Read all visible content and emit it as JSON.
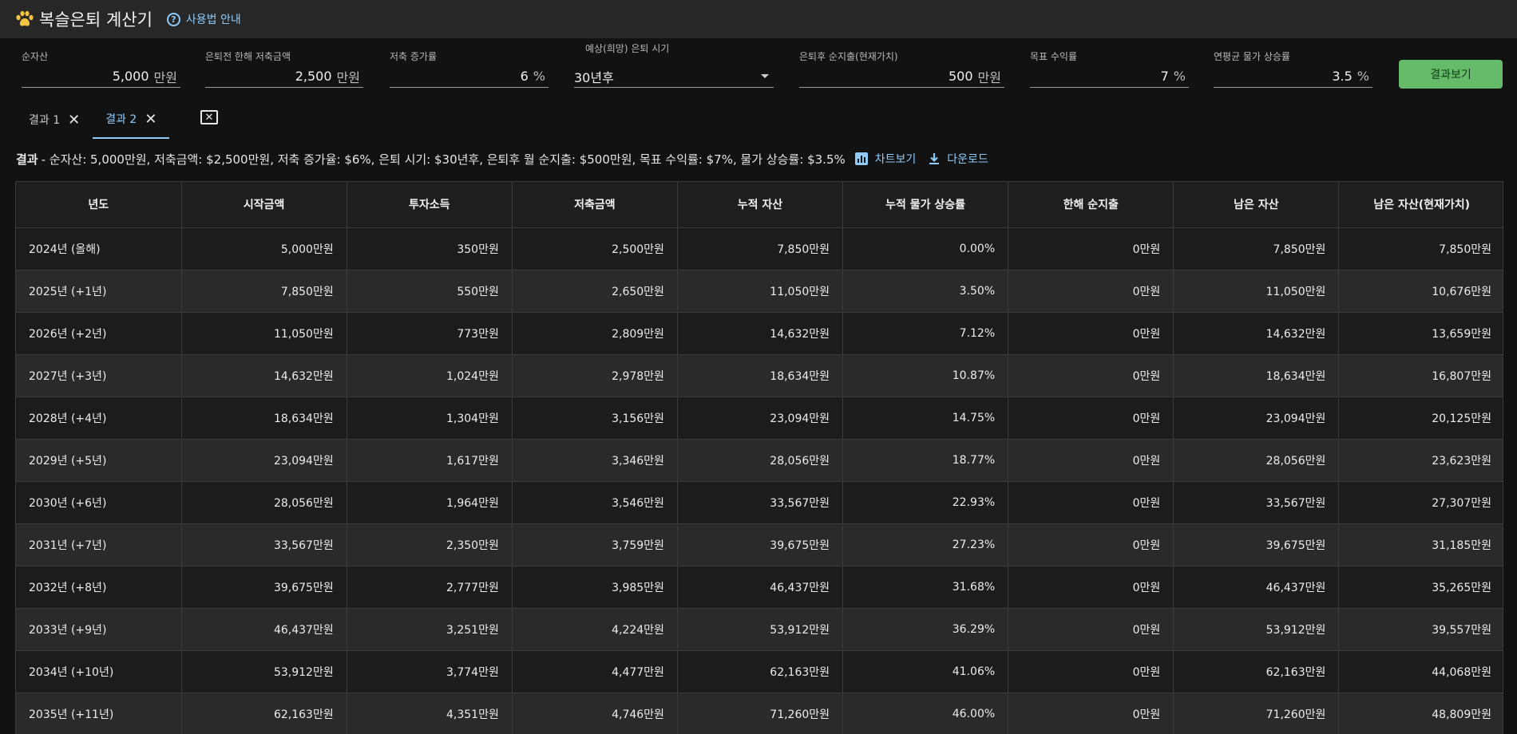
{
  "app": {
    "title": "복슬은퇴 계산기",
    "help_label": "사용법 안내"
  },
  "inputs": {
    "net_assets": {
      "label": "순자산",
      "value": "5,000",
      "unit": "만원"
    },
    "annual_savings": {
      "label": "은퇴전 한해 저축금액",
      "value": "2,500",
      "unit": "만원"
    },
    "savings_growth": {
      "label": "저축 증가률",
      "value": "6",
      "unit": "%"
    },
    "retire_time": {
      "label": "예상(희망) 은퇴 시기",
      "value": "30년후"
    },
    "post_spend": {
      "label": "은퇴후 순지출(현재가치)",
      "value": "500",
      "unit": "만원"
    },
    "target_return": {
      "label": "목표 수익률",
      "value": "7",
      "unit": "%"
    },
    "inflation": {
      "label": "연평균 물가 상승률",
      "value": "3.5",
      "unit": "%"
    }
  },
  "result_button": "결과보기",
  "tabs": [
    {
      "label": "결과 1"
    },
    {
      "label": "결과 2"
    }
  ],
  "summary": {
    "heading": "결과",
    "text": "- 순자산: 5,000만원, 저축금액: $2,500만원, 저축 증가율: $6%, 은퇴 시기: $30년후, 은퇴후 월 순지출: $500만원, 목표 수익률: $7%, 물가 상승률: $3.5%",
    "chart_label": "차트보기",
    "download_label": "다운로드"
  },
  "colors": {
    "accent": "#90caf9",
    "button": "#66bb6a",
    "background": "#121212"
  },
  "table": {
    "headers": [
      "년도",
      "시작금액",
      "투자소득",
      "저축금액",
      "누적 자산",
      "누적 물가 상승률",
      "한해 순지출",
      "남은 자산",
      "남은 자산(현재가치)"
    ],
    "rows": [
      [
        "2024년 (올해)",
        "5,000만원",
        "350만원",
        "2,500만원",
        "7,850만원",
        "0.00%",
        "0만원",
        "7,850만원",
        "7,850만원"
      ],
      [
        "2025년 (+1년)",
        "7,850만원",
        "550만원",
        "2,650만원",
        "11,050만원",
        "3.50%",
        "0만원",
        "11,050만원",
        "10,676만원"
      ],
      [
        "2026년 (+2년)",
        "11,050만원",
        "773만원",
        "2,809만원",
        "14,632만원",
        "7.12%",
        "0만원",
        "14,632만원",
        "13,659만원"
      ],
      [
        "2027년 (+3년)",
        "14,632만원",
        "1,024만원",
        "2,978만원",
        "18,634만원",
        "10.87%",
        "0만원",
        "18,634만원",
        "16,807만원"
      ],
      [
        "2028년 (+4년)",
        "18,634만원",
        "1,304만원",
        "3,156만원",
        "23,094만원",
        "14.75%",
        "0만원",
        "23,094만원",
        "20,125만원"
      ],
      [
        "2029년 (+5년)",
        "23,094만원",
        "1,617만원",
        "3,346만원",
        "28,056만원",
        "18.77%",
        "0만원",
        "28,056만원",
        "23,623만원"
      ],
      [
        "2030년 (+6년)",
        "28,056만원",
        "1,964만원",
        "3,546만원",
        "33,567만원",
        "22.93%",
        "0만원",
        "33,567만원",
        "27,307만원"
      ],
      [
        "2031년 (+7년)",
        "33,567만원",
        "2,350만원",
        "3,759만원",
        "39,675만원",
        "27.23%",
        "0만원",
        "39,675만원",
        "31,185만원"
      ],
      [
        "2032년 (+8년)",
        "39,675만원",
        "2,777만원",
        "3,985만원",
        "46,437만원",
        "31.68%",
        "0만원",
        "46,437만원",
        "35,265만원"
      ],
      [
        "2033년 (+9년)",
        "46,437만원",
        "3,251만원",
        "4,224만원",
        "53,912만원",
        "36.29%",
        "0만원",
        "53,912만원",
        "39,557만원"
      ],
      [
        "2034년 (+10년)",
        "53,912만원",
        "3,774만원",
        "4,477만원",
        "62,163만원",
        "41.06%",
        "0만원",
        "62,163만원",
        "44,068만원"
      ],
      [
        "2035년 (+11년)",
        "62,163만원",
        "4,351만원",
        "4,746만원",
        "71,260만원",
        "46.00%",
        "0만원",
        "71,260만원",
        "48,809만원"
      ]
    ]
  }
}
